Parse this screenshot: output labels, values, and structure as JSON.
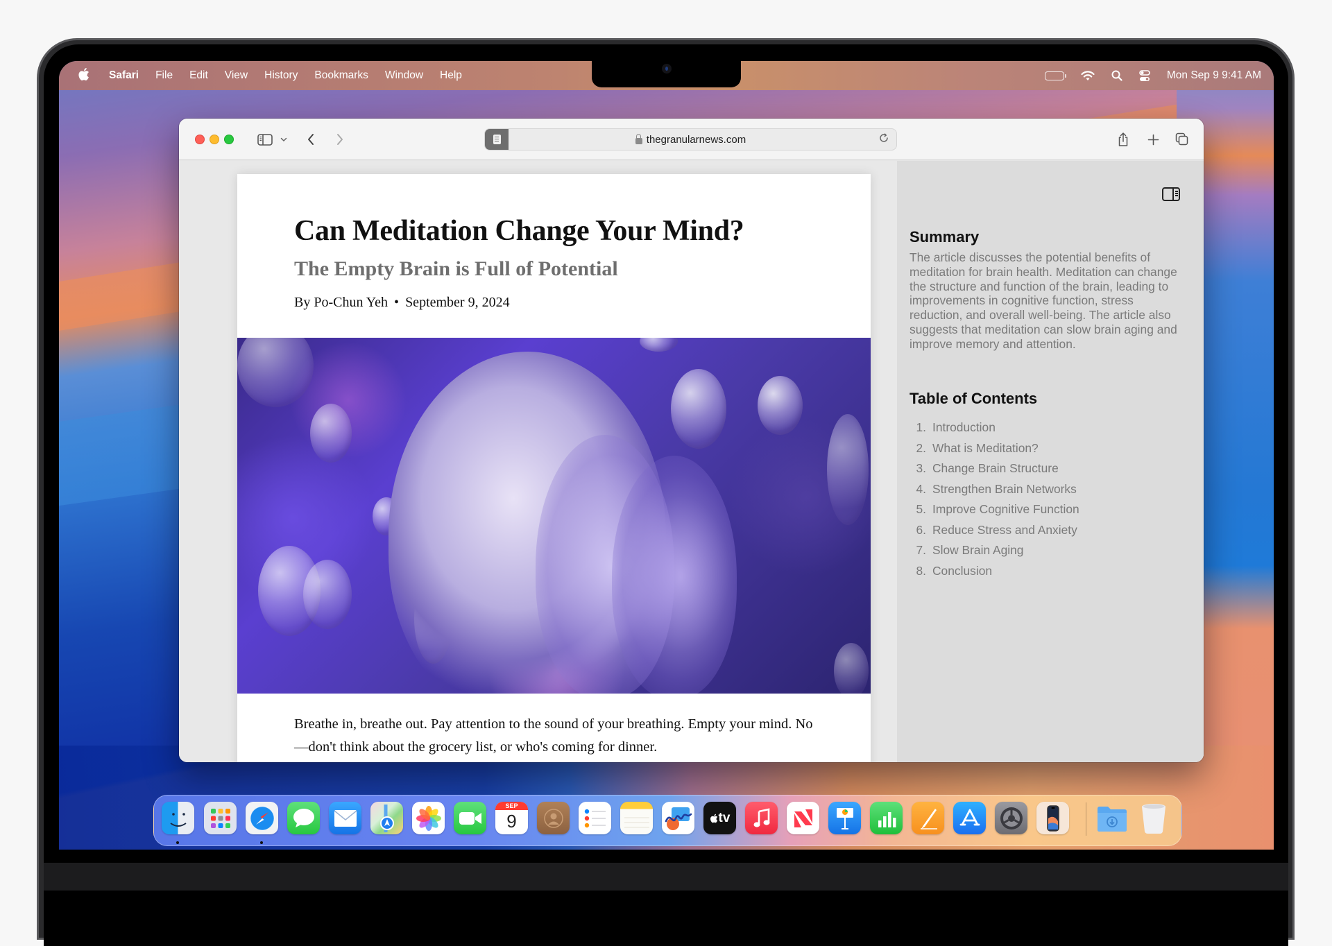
{
  "menubar": {
    "app_name": "Safari",
    "items": [
      "File",
      "Edit",
      "View",
      "History",
      "Bookmarks",
      "Window",
      "Help"
    ],
    "status_icons": [
      "battery-icon",
      "wifi-icon",
      "spotlight-search-icon",
      "control-center-icon"
    ],
    "clock": "Mon Sep 9  9:41 AM",
    "battery_level": 1.0
  },
  "browser": {
    "url": "thegranularnews.com",
    "toolbar_icons": [
      "sidebar-icon",
      "chevron-down-icon",
      "back-icon",
      "forward-icon",
      "reader-icon",
      "lock-icon",
      "reload-icon",
      "share-icon",
      "new-tab-icon",
      "tab-overview-icon"
    ]
  },
  "article": {
    "title": "Can Meditation Change Your Mind?",
    "subtitle": "The Empty Brain is Full of Potential",
    "author": "By Po-Chun Yeh",
    "separator": "•",
    "date": "September 9, 2024",
    "image_alt": "Illustration of translucent purple heads in profile surrounded by floating bubbles",
    "body": "Breathe in, breathe out. Pay attention to the sound of your breathing. Empty your mind. No—don't think about the grocery list, or who's coming for dinner."
  },
  "sidebar": {
    "summary_heading": "Summary",
    "summary_text": "The article discusses the potential benefits of meditation for brain health. Meditation can change the structure and function of the brain, leading to improvements in cognitive function, stress reduction, and overall well-being. The article also suggests that meditation can slow brain aging and improve memory and attention.",
    "toc_heading": "Table of Contents",
    "toc": [
      {
        "num": "1.",
        "label": "Introduction"
      },
      {
        "num": "2.",
        "label": "What is Meditation?"
      },
      {
        "num": "3.",
        "label": "Change Brain Structure"
      },
      {
        "num": "4.",
        "label": "Strengthen Brain Networks"
      },
      {
        "num": "5.",
        "label": "Improve Cognitive Function"
      },
      {
        "num": "6.",
        "label": "Reduce Stress and Anxiety"
      },
      {
        "num": "7.",
        "label": "Slow Brain Aging"
      },
      {
        "num": "8.",
        "label": "Conclusion"
      }
    ]
  },
  "dock": {
    "apps": [
      {
        "name": "Finder",
        "running": true
      },
      {
        "name": "Launchpad",
        "running": false
      },
      {
        "name": "Safari",
        "running": true
      },
      {
        "name": "Messages",
        "running": false
      },
      {
        "name": "Mail",
        "running": false
      },
      {
        "name": "Maps",
        "running": false
      },
      {
        "name": "Photos",
        "running": false
      },
      {
        "name": "FaceTime",
        "running": false
      },
      {
        "name": "Calendar",
        "running": false,
        "month": "SEP",
        "day": "9"
      },
      {
        "name": "Contacts",
        "running": false
      },
      {
        "name": "Reminders",
        "running": false
      },
      {
        "name": "Notes",
        "running": false
      },
      {
        "name": "Freeform",
        "running": false
      },
      {
        "name": "TV",
        "running": false,
        "label": "tv"
      },
      {
        "name": "Music",
        "running": false
      },
      {
        "name": "News",
        "running": false
      },
      {
        "name": "Keynote",
        "running": false
      },
      {
        "name": "Numbers",
        "running": false
      },
      {
        "name": "Pages",
        "running": false
      },
      {
        "name": "App Store",
        "running": false
      },
      {
        "name": "System Settings",
        "running": false
      },
      {
        "name": "iPhone Mirroring",
        "running": false
      },
      {
        "name": "Downloads",
        "running": false
      },
      {
        "name": "Trash",
        "running": false
      }
    ]
  },
  "colors": {
    "close": "#fe5f57",
    "minimize": "#febc2e",
    "maximize": "#28c840",
    "sidebar_bg": "#dcdcdc",
    "summary_text": "#7a7a7a"
  }
}
